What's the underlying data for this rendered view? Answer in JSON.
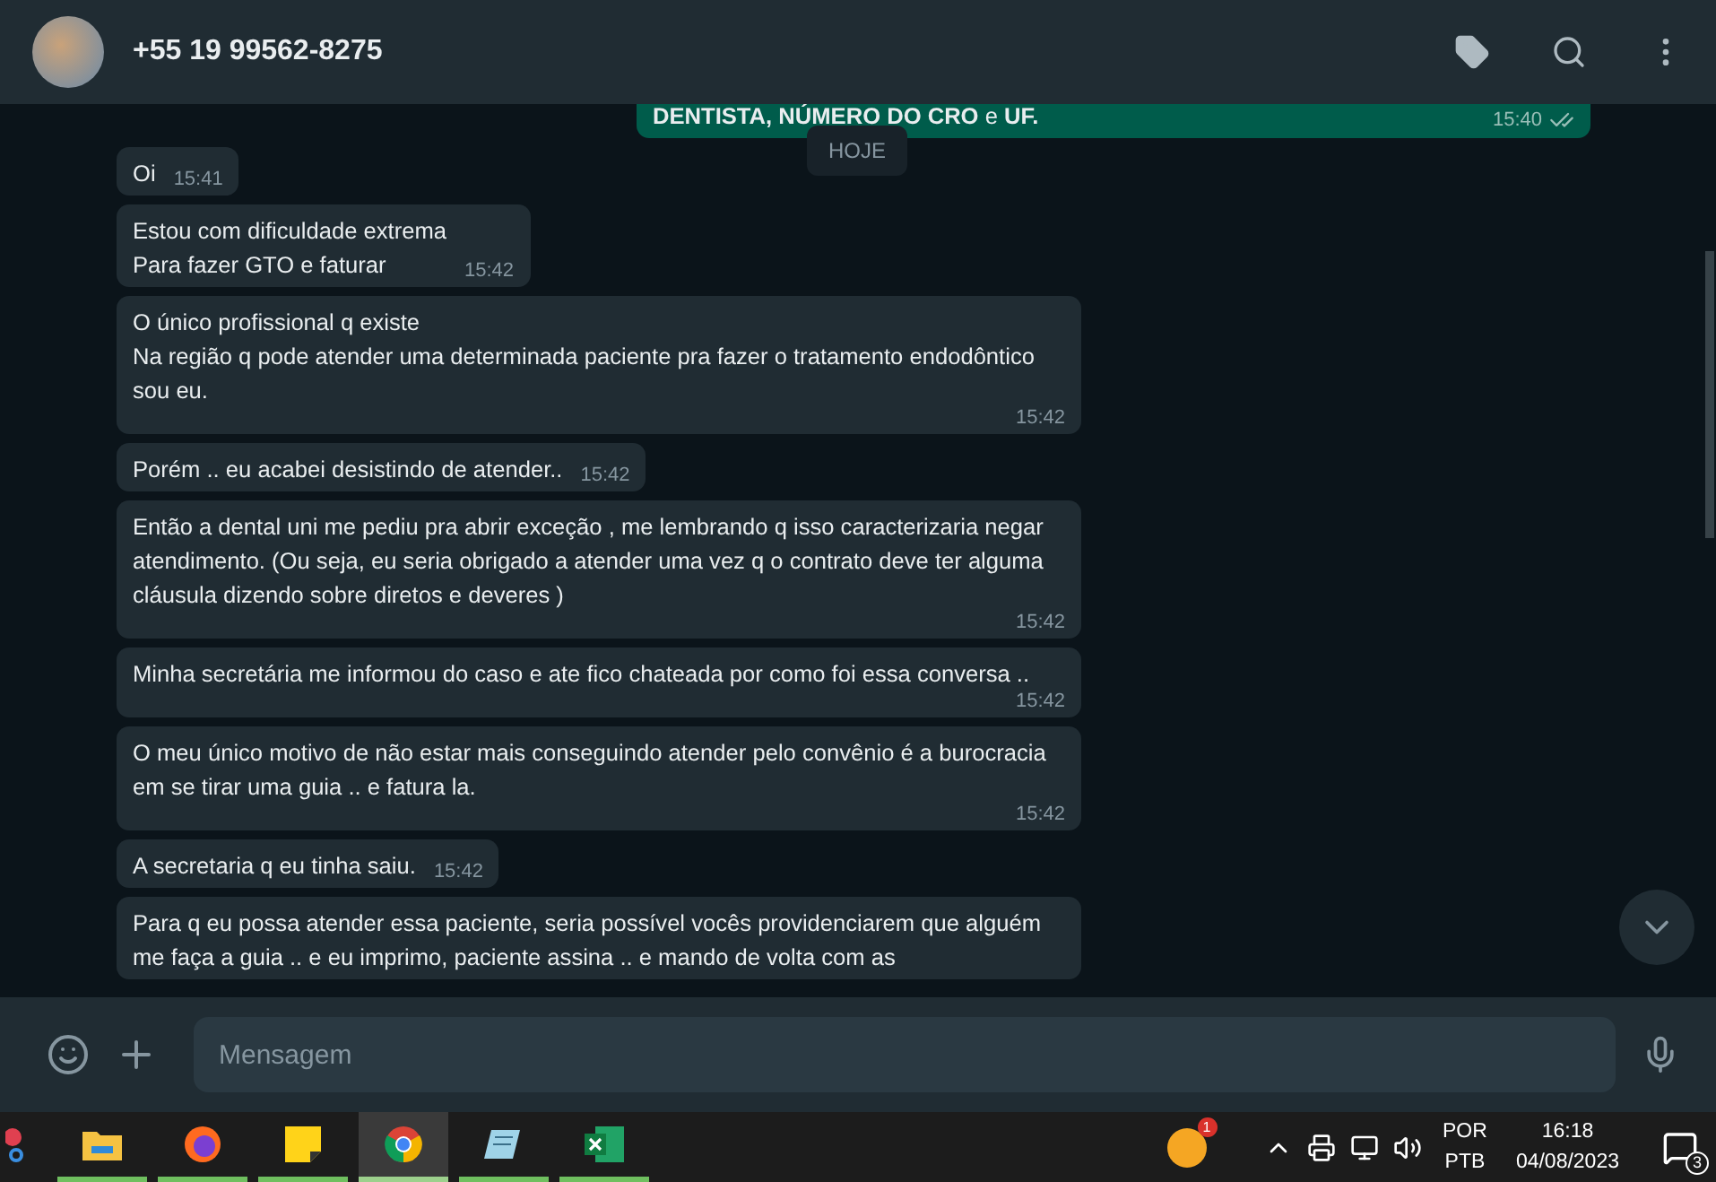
{
  "header": {
    "contact": "+55 19 99562-8275"
  },
  "chat": {
    "date_badge": "HOJE",
    "messages": [
      {
        "kind": "outgoing",
        "text": "**DENTISTA, NÚMERO DO CRO** e **UF.**",
        "time": "15:40",
        "read": false
      },
      {
        "kind": "incoming",
        "text": "Oi",
        "time": "15:41"
      },
      {
        "kind": "incoming",
        "text": "Estou com dificuldade extrema\nPara fazer GTO e faturar",
        "time": "15:42"
      },
      {
        "kind": "incoming",
        "text": "O único profissional q existe\nNa região q pode atender uma determinada paciente pra fazer o tratamento endodôntico sou eu.",
        "time": "15:42"
      },
      {
        "kind": "incoming",
        "text": "Porém .. eu acabei desistindo de atender..",
        "time": "15:42"
      },
      {
        "kind": "incoming",
        "text": "Então a dental uni me pediu pra abrir exceção , me lembrando q isso caracterizaria negar atendimento. (Ou seja, eu seria obrigado a atender uma vez q o contrato deve ter alguma cláusula dizendo sobre diretos e deveres )",
        "time": "15:42"
      },
      {
        "kind": "incoming",
        "text": "Minha secretária me informou do caso e ate fico chateada por como foi essa conversa ..",
        "time": "15:42"
      },
      {
        "kind": "incoming",
        "text": "O meu único motivo de não estar mais conseguindo atender pelo convênio é a burocracia em se tirar uma guia .. e fatura la.",
        "time": "15:42"
      },
      {
        "kind": "incoming",
        "text": "A secretaria q eu tinha saiu.",
        "time": "15:42"
      },
      {
        "kind": "incoming",
        "text": "Para q eu possa atender essa paciente, seria possível vocês providenciarem que alguém me faça a guia .. e eu imprimo, paciente assina .. e mando de volta com as"
      }
    ]
  },
  "composer": {
    "placeholder": "Mensagem"
  },
  "taskbar": {
    "apps": [
      {
        "kind": "snip",
        "selected": false,
        "running": false
      },
      {
        "kind": "folder",
        "selected": false,
        "running": true
      },
      {
        "kind": "firefox",
        "selected": false,
        "running": true
      },
      {
        "kind": "notes",
        "selected": false,
        "running": true
      },
      {
        "kind": "chrome",
        "selected": true,
        "running": true
      },
      {
        "kind": "notepad",
        "selected": false,
        "running": true
      },
      {
        "kind": "excel",
        "selected": false,
        "running": true
      }
    ],
    "tray_badge": "1",
    "language": "POR",
    "layout": "PTB",
    "time": "16:18",
    "date": "04/08/2023",
    "notifications": "3"
  }
}
